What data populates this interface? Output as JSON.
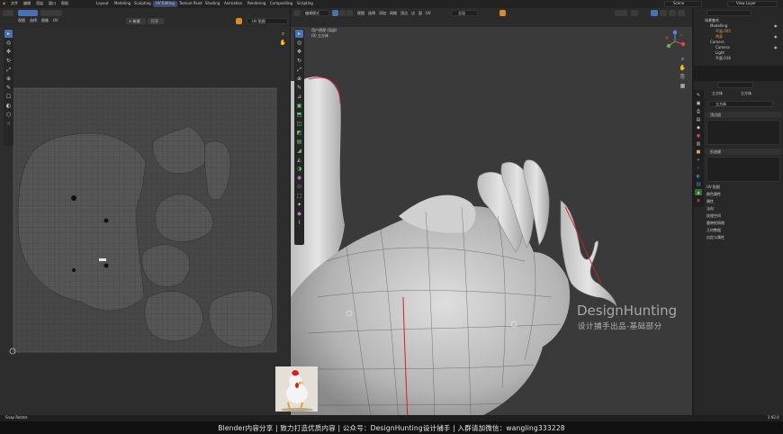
{
  "app": {
    "title": "Blender UV Editing"
  },
  "topbar": {
    "menus": [
      "文件",
      "编辑",
      "渲染",
      "窗口",
      "帮助"
    ],
    "workspaces": [
      "Layout",
      "Modeling",
      "Sculpting",
      "UV Editing",
      "Texture Paint",
      "Shading",
      "Animation",
      "Rendering",
      "Compositing",
      "Scripting"
    ],
    "scene": "Scene",
    "view_layer": "View Layer"
  },
  "uv_editor": {
    "menus": [
      "视图",
      "选择",
      "图像",
      "UV"
    ],
    "new_label": "+ 新建",
    "open_label": "打开",
    "image_name": "UV 贴图"
  },
  "viewport": {
    "mode": "编辑模式",
    "menus": [
      "视图",
      "选择",
      "添加",
      "网格",
      "顶点",
      "边",
      "面",
      "UV"
    ],
    "transform": "全局",
    "view_name": "用户透视 (局部)",
    "object_name": "(0) 立方体"
  },
  "outliner": {
    "rows": [
      "场景集合",
      "Modelling",
      "平面.005",
      "鸡身",
      "Camera",
      "Camera",
      "Light",
      "平面.016"
    ]
  },
  "properties": {
    "object": "立方体",
    "data": "立方体",
    "search": "立方体",
    "panels": [
      "顶点组",
      "形态键"
    ],
    "sub_panels": [
      "UV 贴图",
      "颜色属性",
      "属性",
      "法向",
      "纹理空间",
      "重映射网格",
      "几何数据",
      "自定义属性"
    ]
  },
  "statusbar": {
    "left": "Snap Rotate",
    "right": "2.92.0"
  },
  "watermark": {
    "brand": "DesignHunting",
    "sub": "设计捕手出品-基础部分"
  },
  "caption": {
    "text": "Blender内容分享  |  致力打造优质内容  |  公众号：DesignHunting设计捕手  |  入群请加微信：wangling333228"
  },
  "colors": {
    "accent": "#4772b3",
    "orange": "#d98b2a",
    "seam": "#d02020",
    "island": "#555555"
  }
}
